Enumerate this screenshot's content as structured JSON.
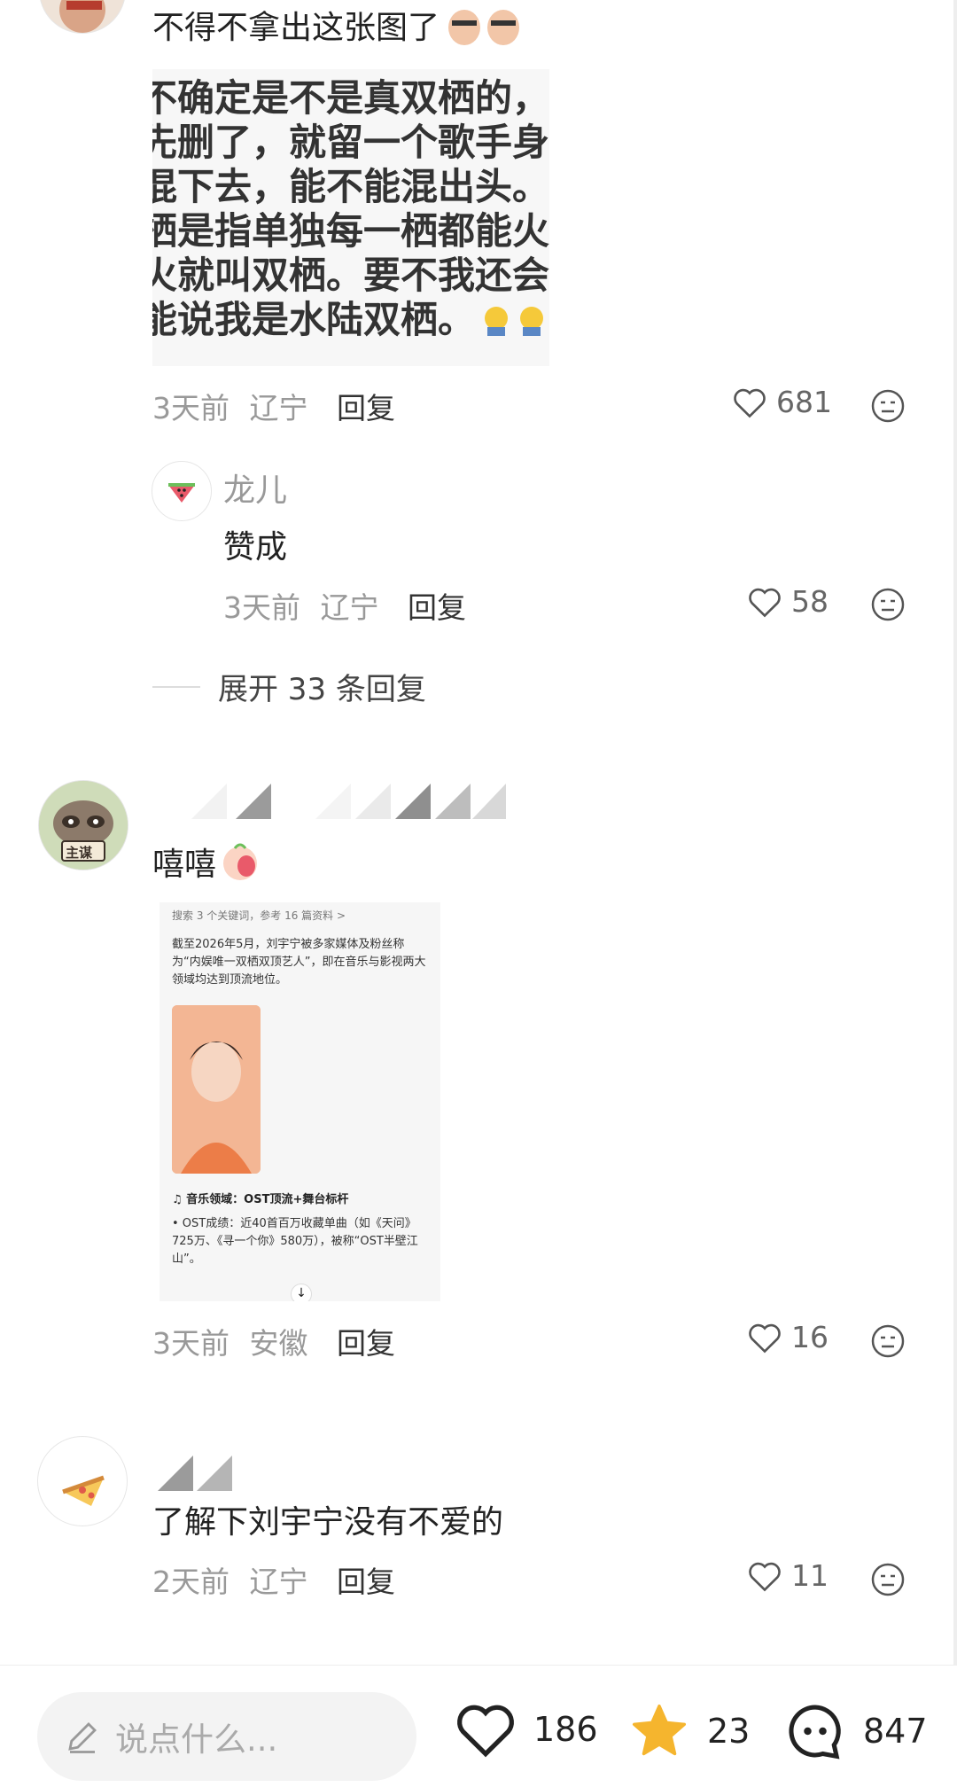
{
  "comment1": {
    "text": "不得不拿出这张图了",
    "image_lines": [
      "不确定是不是真双栖的，",
      "先删了，就留一个歌手身",
      "混下去，能不能混出头。",
      "栖是指单独每一栖都能火",
      "火就叫双栖。要不我还会",
      "能说我是水陆双栖。"
    ],
    "time": "3天前",
    "location": "辽宁",
    "reply_label": "回复",
    "likes": "681"
  },
  "reply1": {
    "author": "龙儿",
    "text": "赞成",
    "time": "3天前",
    "location": "辽宁",
    "reply_label": "回复",
    "likes": "58"
  },
  "expand": {
    "label": "展开 33 条回复"
  },
  "comment2": {
    "text": "嘻嘻",
    "avatar_text": "主谋",
    "image": {
      "search_line": "搜索 3 个关键词，参考 16 篇资料 >",
      "para1": "截至2026年5月，刘宇宁被多家媒体及粉丝称为“内娱唯一双栖双顶艺人”，即在音乐与影视两大领域均达到顶流地位。",
      "section_title": "♫ 音乐领域：OST顶流+舞台标杆",
      "bullet": "• OST成绩：近40首百万收藏单曲（如《天问》725万、《寻一个你》580万），被称“OST半壁江山”。"
    },
    "time": "3天前",
    "location": "安徽",
    "reply_label": "回复",
    "likes": "16"
  },
  "comment3": {
    "text": "了解下刘宇宁没有不爱的",
    "time": "2天前",
    "location": "辽宁",
    "reply_label": "回复",
    "likes": "11"
  },
  "bottom": {
    "input_placeholder": "说点什么...",
    "likes": "186",
    "favorites": "23",
    "comments": "847"
  },
  "colors": {
    "star": "#f5b52e",
    "text": "#222222",
    "meta": "#999999"
  }
}
